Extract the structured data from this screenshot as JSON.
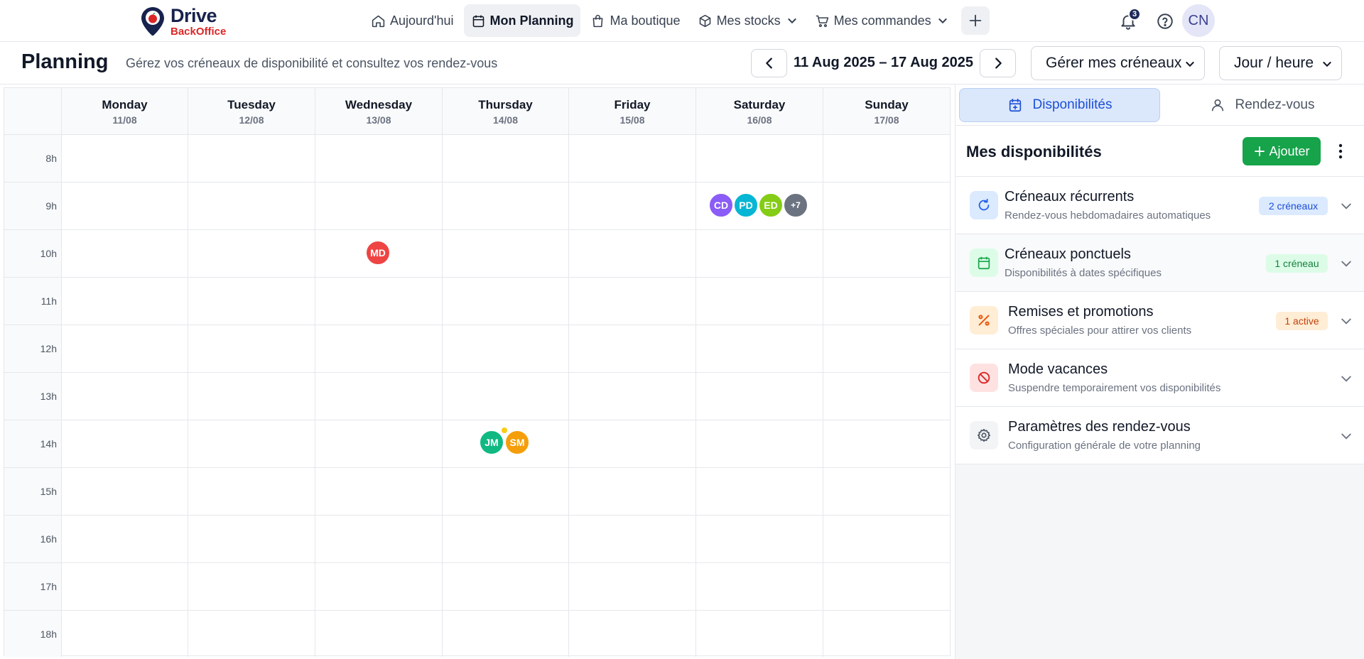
{
  "brand": {
    "name": "Drive",
    "sub": "BackOffice"
  },
  "nav": {
    "today": "Aujourd'hui",
    "planning": "Mon Planning",
    "shop": "Ma boutique",
    "stocks": "Mes stocks",
    "orders": "Mes commandes"
  },
  "header_right": {
    "notifications": "3",
    "avatar": "CN"
  },
  "page": {
    "title": "Planning",
    "subtitle": "Gérez vos créneaux de disponibilité et consultez vos rendez-vous",
    "date_range": "11 Aug 2025 – 17 Aug 2025",
    "slots_select": "Gérer mes créneaux",
    "view_select": "Jour / heure"
  },
  "calendar": {
    "days": [
      {
        "name": "Monday",
        "date": "11/08"
      },
      {
        "name": "Tuesday",
        "date": "12/08"
      },
      {
        "name": "Wednesday",
        "date": "13/08"
      },
      {
        "name": "Thursday",
        "date": "14/08"
      },
      {
        "name": "Friday",
        "date": "15/08"
      },
      {
        "name": "Saturday",
        "date": "16/08"
      },
      {
        "name": "Sunday",
        "date": "17/08"
      }
    ],
    "hours": [
      "8h",
      "9h",
      "10h",
      "11h",
      "12h",
      "13h",
      "14h",
      "15h",
      "16h",
      "17h",
      "18h"
    ],
    "appointments": {
      "wed10": [
        "MD"
      ],
      "thu14": [
        "JM",
        "SM"
      ],
      "sat9": [
        "CD",
        "PD",
        "ED",
        "+7"
      ]
    },
    "colors": {
      "MD": "#ef4444",
      "JM": "#10b981",
      "SM": "#f59e0b",
      "CD": "#8b5cf6",
      "PD": "#06b6d4",
      "ED": "#84cc16",
      "more": "#6b7280"
    }
  },
  "panel": {
    "tab_availability": "Disponibilités",
    "tab_appointments": "Rendez-vous",
    "title": "Mes disponibilités",
    "add_button": "Ajouter",
    "sections": [
      {
        "title": "Créneaux récurrents",
        "desc": "Rendez-vous hebdomadaires automatiques",
        "badge": "2 créneaux"
      },
      {
        "title": "Créneaux ponctuels",
        "desc": "Disponibilités à dates spécifiques",
        "badge": "1 créneau"
      },
      {
        "title": "Remises et promotions",
        "desc": "Offres spéciales pour attirer vos clients",
        "badge": "1 active"
      },
      {
        "title": "Mode vacances",
        "desc": "Suspendre temporairement vos disponibilités",
        "badge": ""
      },
      {
        "title": "Paramètres des rendez-vous",
        "desc": "Configuration générale de votre planning",
        "badge": ""
      }
    ]
  }
}
